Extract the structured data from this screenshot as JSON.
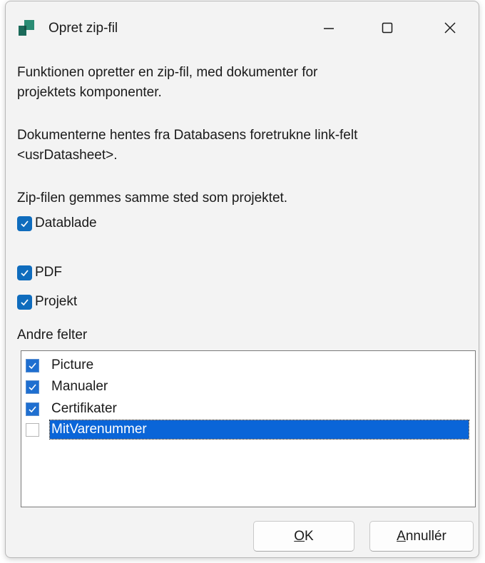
{
  "window": {
    "title": "Opret zip-fil",
    "controls": {
      "minimize": "minimize-icon",
      "maximize": "maximize-icon",
      "close": "close-icon"
    }
  },
  "description": {
    "line1": "Funktionen opretter en zip-fil, med dokumenter for",
    "line2": "projektets komponenter.",
    "line3": "Dokumenterne hentes fra Databasens foretrukne link-felt",
    "line4": "<usrDatasheet>.",
    "line5": "Zip-filen gemmes samme sted som projektet."
  },
  "options": [
    {
      "label": "Datablade",
      "checked": true
    },
    {
      "label": "PDF",
      "checked": true
    },
    {
      "label": "Projekt",
      "checked": true
    }
  ],
  "other_fields": {
    "label": "Andre felter",
    "items": [
      {
        "label": "Picture",
        "checked": true,
        "selected": false
      },
      {
        "label": "Manualer",
        "checked": true,
        "selected": false
      },
      {
        "label": "Certifikater",
        "checked": true,
        "selected": false
      },
      {
        "label": "MitVarenummer",
        "checked": false,
        "selected": true
      }
    ]
  },
  "buttons": {
    "ok_mnemonic": "O",
    "ok_rest": "K",
    "cancel_mnemonic": "A",
    "cancel_rest": "nnullér"
  },
  "colors": {
    "accent": "#0f6cbd",
    "selection": "#0a65d8",
    "window_bg": "#f3f3f3"
  }
}
